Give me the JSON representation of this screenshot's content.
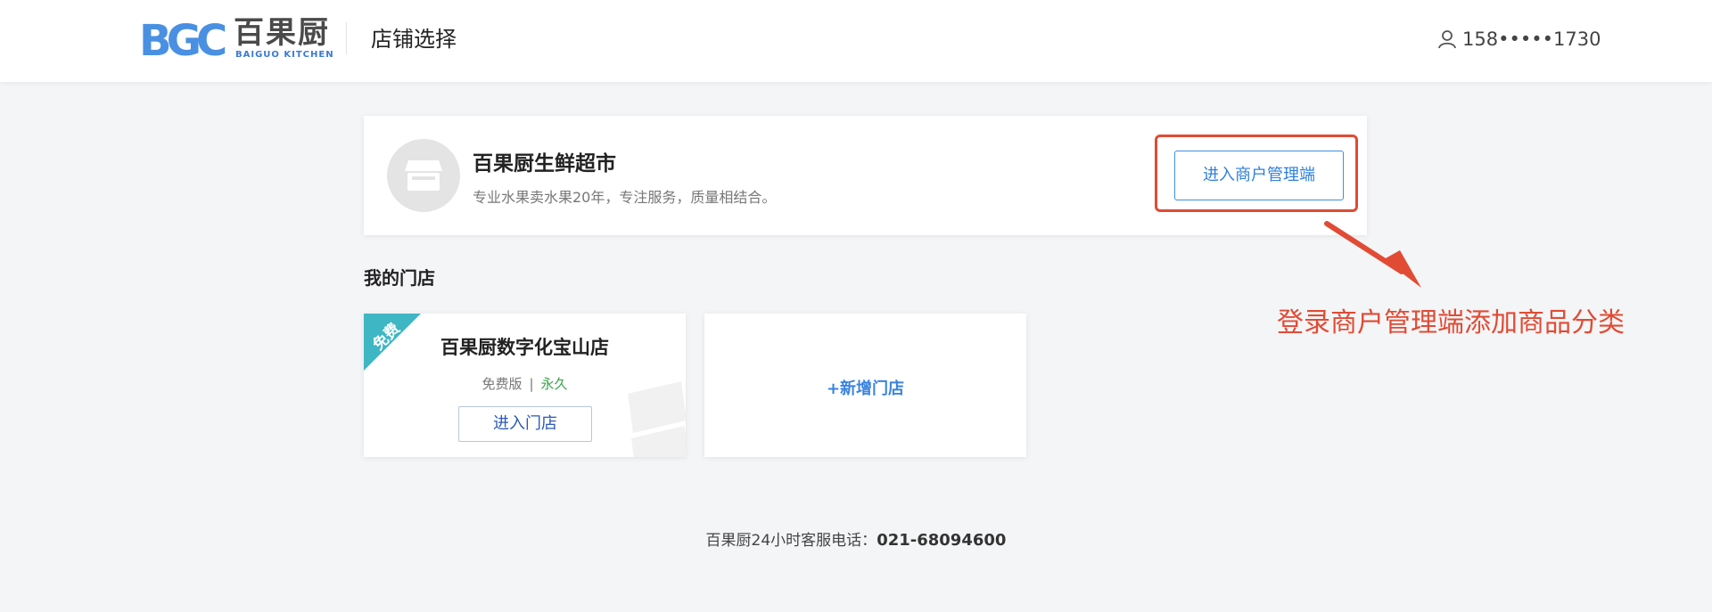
{
  "header": {
    "logo_cn": "百果厨",
    "logo_en": "BAIGUO KITCHEN",
    "title": "店铺选择",
    "user_phone": "158•••••1730"
  },
  "merchant": {
    "name": "百果厨生鲜超市",
    "description": "专业水果卖水果20年，专注服务，质量相结合。",
    "manage_button": "进入商户管理端"
  },
  "stores_section": {
    "title": "我的门店",
    "stores": [
      {
        "badge": "免费",
        "name": "百果厨数字化宝山店",
        "plan": "免费版",
        "separator": "|",
        "period": "永久",
        "enter_button": "进入门店"
      }
    ],
    "add_store_label": "+新增门店"
  },
  "annotation": {
    "text": "登录商户管理端添加商品分类",
    "color": "#e14b34"
  },
  "footer": {
    "label": "百果厨24小时客服电话：",
    "phone": "021-68094600"
  },
  "colors": {
    "brand_blue": "#3f8ee6",
    "ribbon_teal": "#3fb6c4",
    "success_green": "#3aa14a"
  },
  "icons": [
    "bgc-logo",
    "user-icon",
    "store-icon",
    "arrow-icon"
  ]
}
